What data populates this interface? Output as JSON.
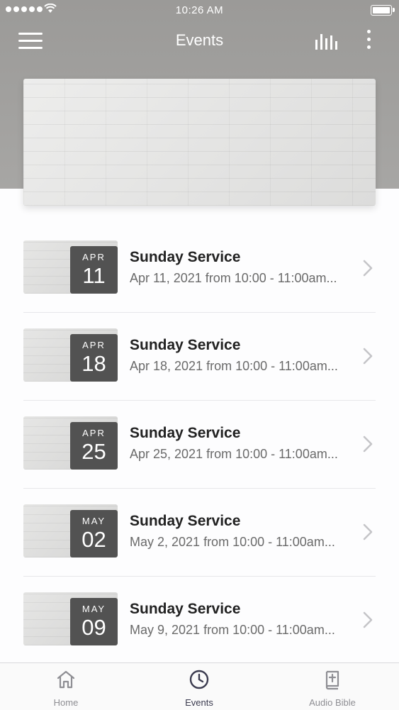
{
  "status_bar": {
    "time": "10:26 AM"
  },
  "header": {
    "title": "Events"
  },
  "icons": {
    "menu": "hamburger-icon",
    "chart": "bar-chart-icon",
    "more": "more-vertical-icon",
    "chevron": "chevron-right-icon"
  },
  "colors": {
    "header_bg": "#a09f9d",
    "badge_bg": "#525252",
    "active_tab": "#3b3b4f",
    "inactive_tab": "#8e8e93"
  },
  "events": [
    {
      "month": "APR",
      "day": "11",
      "title": "Sunday Service",
      "subtitle": "Apr 11, 2021 from 10:00 - 11:00am..."
    },
    {
      "month": "APR",
      "day": "18",
      "title": "Sunday Service",
      "subtitle": "Apr 18, 2021 from 10:00 - 11:00am..."
    },
    {
      "month": "APR",
      "day": "25",
      "title": "Sunday Service",
      "subtitle": "Apr 25, 2021 from 10:00 - 11:00am..."
    },
    {
      "month": "MAY",
      "day": "02",
      "title": "Sunday Service",
      "subtitle": "May 2, 2021 from 10:00 - 11:00am..."
    },
    {
      "month": "MAY",
      "day": "09",
      "title": "Sunday Service",
      "subtitle": "May 9, 2021 from 10:00 - 11:00am..."
    }
  ],
  "tabs": [
    {
      "label": "Home",
      "icon": "home-icon"
    },
    {
      "label": "Events",
      "icon": "clock-icon"
    },
    {
      "label": "Audio Bible",
      "icon": "bible-icon"
    }
  ]
}
